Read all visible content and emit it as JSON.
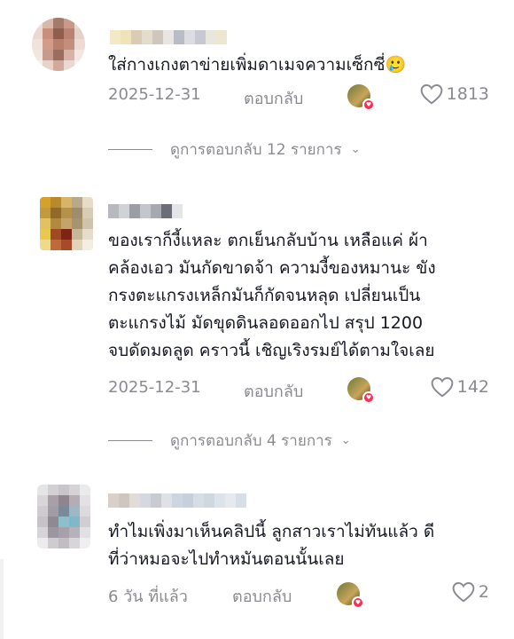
{
  "comments": [
    {
      "username": "",
      "text": "ใส่กางเกงตาข่ายเพิ่มดาเมจความเซ็กซี่🥲",
      "date": "2025-12-31",
      "reply_label": "ตอบกลับ",
      "likes": "1813",
      "view_replies": "ดูการตอบกลับ 12 รายการ"
    },
    {
      "username": "",
      "text_lines": [
        "ของเราก็งี้แหละ ตกเย็นกลับบ้าน เหลือแค่ ผ้า",
        "คล้องเอว มันกัดขาดจ้า ความงี้ของหมานะ ขัง",
        "กรงตะแกรงเหล็กมันก็กัดจนหลุด เปลี่ยนเป็น",
        "ตะแกรงไม้ มัดขุดดินลอดออกไป สรุป 1200",
        "จบดัดมดลูด คราวนี้ เชิญเริงรมย์ได้ตามใจเลย"
      ],
      "date": "2025-12-31",
      "reply_label": "ตอบกลับ",
      "likes": "142",
      "view_replies": "ดูการตอบกลับ 4 รายการ"
    },
    {
      "username": "",
      "text_lines": [
        "ทำไมเพิ่งมาเห็นคลิปนี้ ลูกสาวเราไม่ทันแล้ว ดี",
        "ที่ว่าหมอจะไปทำหมันตอนนั้นเลย"
      ],
      "date": "6 วัน ที่แล้ว",
      "reply_label": "ตอบกลับ",
      "likes": "2"
    }
  ],
  "colors": {
    "text": "#161823",
    "secondary": "#8a8b91",
    "like_badge": "#fe2c55"
  },
  "icons": {
    "like": "heart-outline-icon",
    "expand": "chevron-down-icon",
    "creator_liked": "creator-heart-badge-icon"
  }
}
